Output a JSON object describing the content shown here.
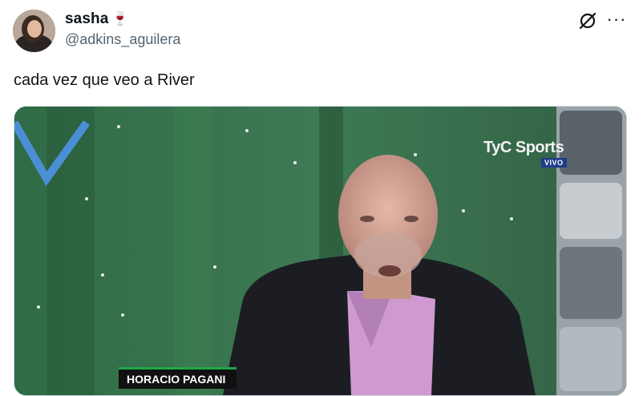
{
  "tweet": {
    "display_name": "sasha",
    "name_emoji": "🍷",
    "handle": "@adkins_aguilera",
    "text": "cada vez que veo a River"
  },
  "actions": {
    "grok_icon": "grok-icon",
    "more_icon": "more-icon",
    "more_label": "···"
  },
  "media": {
    "channel_logo": "TyC Sports",
    "live_badge": "VIVO",
    "lower_third_name": "HORACIO PAGANI"
  }
}
